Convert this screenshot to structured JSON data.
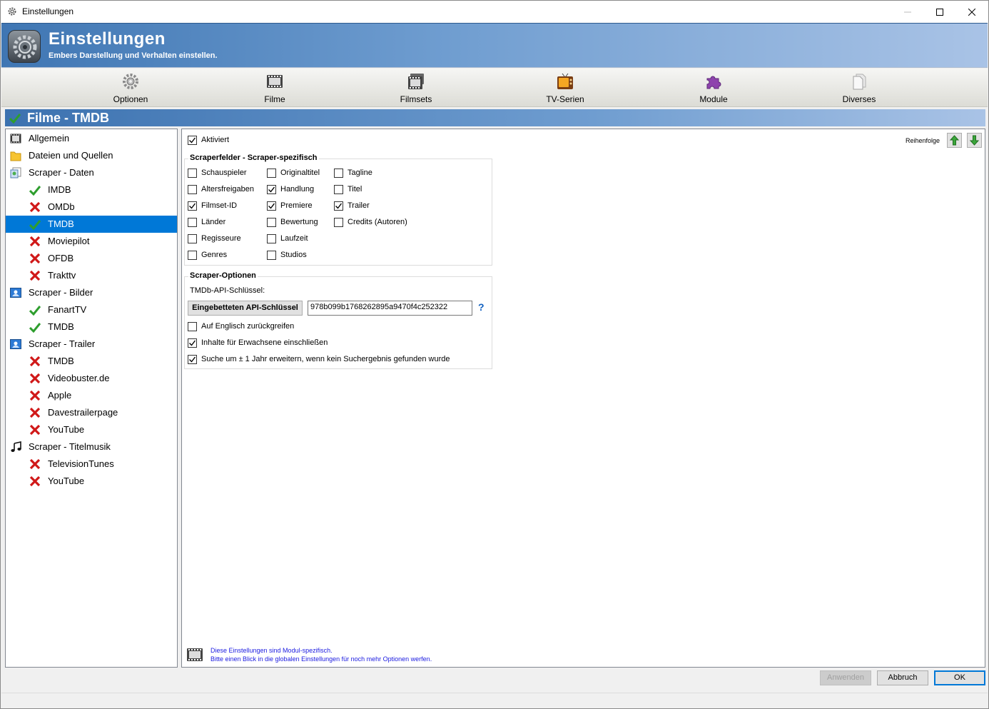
{
  "window": {
    "title": "Einstellungen"
  },
  "banner": {
    "title": "Einstellungen",
    "subtitle": "Embers Darstellung und Verhalten einstellen."
  },
  "toolbar": {
    "items": [
      {
        "label": "Optionen",
        "icon": "gear-icon"
      },
      {
        "label": "Filme",
        "icon": "film-icon"
      },
      {
        "label": "Filmsets",
        "icon": "filmset-icon"
      },
      {
        "label": "TV-Serien",
        "icon": "tv-icon"
      },
      {
        "label": "Module",
        "icon": "puzzle-icon"
      },
      {
        "label": "Diverses",
        "icon": "document-icon"
      }
    ]
  },
  "section": {
    "title": "Filme - TMDB"
  },
  "tree": {
    "items": [
      {
        "label": "Allgemein",
        "icon": "film-icon",
        "level": 0
      },
      {
        "label": "Dateien und Quellen",
        "icon": "folder-icon",
        "level": 0
      },
      {
        "label": "Scraper - Daten",
        "icon": "scraper-data-icon",
        "level": 0
      },
      {
        "label": "IMDB",
        "icon": "check-icon",
        "level": 1
      },
      {
        "label": "OMDb",
        "icon": "cross-icon",
        "level": 1
      },
      {
        "label": "TMDB",
        "icon": "check-icon",
        "level": 1,
        "selected": true
      },
      {
        "label": "Moviepilot",
        "icon": "cross-icon",
        "level": 1
      },
      {
        "label": "OFDB",
        "icon": "cross-icon",
        "level": 1
      },
      {
        "label": "Trakttv",
        "icon": "cross-icon",
        "level": 1
      },
      {
        "label": "Scraper - Bilder",
        "icon": "image-icon",
        "level": 0
      },
      {
        "label": "FanartTV",
        "icon": "check-icon",
        "level": 1
      },
      {
        "label": "TMDB",
        "icon": "check-icon",
        "level": 1
      },
      {
        "label": "Scraper - Trailer",
        "icon": "image-icon",
        "level": 0
      },
      {
        "label": "TMDB",
        "icon": "cross-icon",
        "level": 1
      },
      {
        "label": "Videobuster.de",
        "icon": "cross-icon",
        "level": 1
      },
      {
        "label": "Apple",
        "icon": "cross-icon",
        "level": 1
      },
      {
        "label": "Davestrailerpage",
        "icon": "cross-icon",
        "level": 1
      },
      {
        "label": "YouTube",
        "icon": "cross-icon",
        "level": 1
      },
      {
        "label": "Scraper - Titelmusik",
        "icon": "music-icon",
        "level": 0
      },
      {
        "label": "TelevisionTunes",
        "icon": "cross-icon",
        "level": 1
      },
      {
        "label": "YouTube",
        "icon": "cross-icon",
        "level": 1
      }
    ]
  },
  "panel": {
    "activated": {
      "label": "Aktiviert",
      "checked": true
    },
    "order": {
      "label": "Reihenfolge"
    },
    "fields_group": {
      "title": "Scraperfelder - Scraper-spezifisch",
      "columns": [
        [
          {
            "label": "Schauspieler",
            "checked": false
          },
          {
            "label": "Altersfreigaben",
            "checked": false
          },
          {
            "label": "Filmset-ID",
            "checked": true
          },
          {
            "label": "Länder",
            "checked": false
          },
          {
            "label": "Regisseure",
            "checked": false
          },
          {
            "label": "Genres",
            "checked": false
          }
        ],
        [
          {
            "label": "Originaltitel",
            "checked": false
          },
          {
            "label": "Handlung",
            "checked": true
          },
          {
            "label": "Premiere",
            "checked": true
          },
          {
            "label": "Bewertung",
            "checked": false
          },
          {
            "label": "Laufzeit",
            "checked": false
          },
          {
            "label": "Studios",
            "checked": false
          }
        ],
        [
          {
            "label": "Tagline",
            "checked": false
          },
          {
            "label": "Titel",
            "checked": false
          },
          {
            "label": "Trailer",
            "checked": true
          },
          {
            "label": "Credits (Autoren)",
            "checked": false
          }
        ]
      ]
    },
    "options_group": {
      "title": "Scraper-Optionen",
      "api_key_label": "TMDb-API-Schlüssel:",
      "embedded_key_button": "Eingebetteten API-Schlüssel",
      "api_key_value": "978b099b1768262895a9470f4c252322",
      "help": "?",
      "options": [
        {
          "label": "Auf Englisch zurückgreifen",
          "checked": false
        },
        {
          "label": "Inhalte für Erwachsene einschließen",
          "checked": true
        },
        {
          "label": "Suche um ± 1 Jahr erweitern, wenn kein Suchergebnis gefunden wurde",
          "checked": true
        }
      ]
    },
    "info": {
      "line1": "Diese Einstellungen sind Modul-spezifisch.",
      "line2": "Bitte einen Blick in die globalen Einstellungen für noch mehr Optionen werfen."
    }
  },
  "footer": {
    "apply": "Anwenden",
    "cancel": "Abbruch",
    "ok": "OK"
  },
  "colors": {
    "accent": "#0078d7",
    "banner": "#3f76b3",
    "check_green": "#2e9e2e",
    "cross_red": "#d01818",
    "info_blue": "#1a1ae0"
  }
}
